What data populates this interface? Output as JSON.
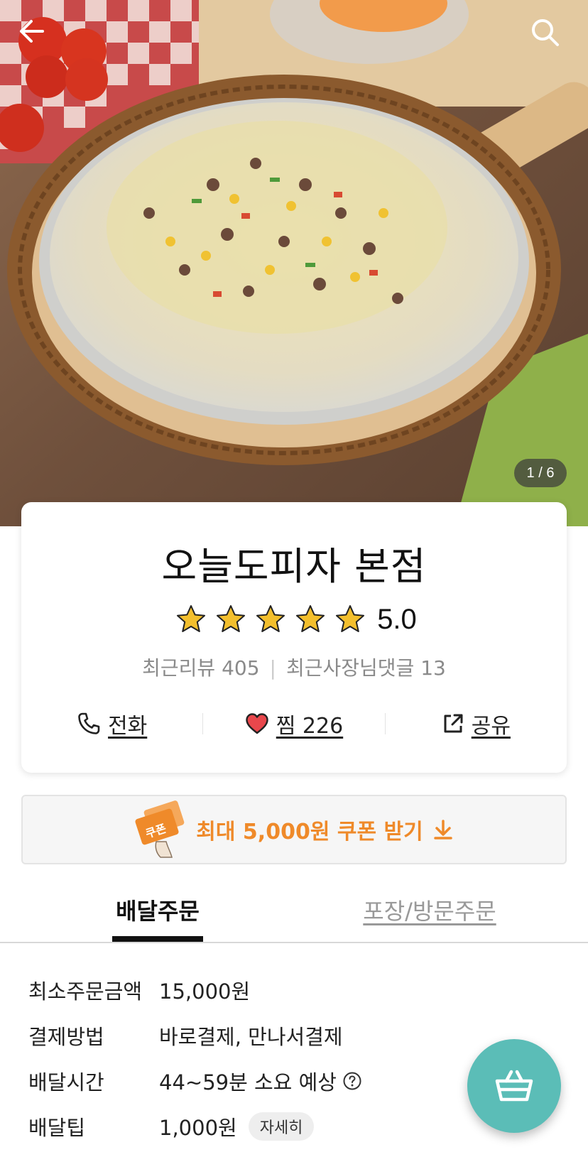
{
  "hero": {
    "page_indicator": "1 / 6"
  },
  "store": {
    "name": "오늘도피자 본점",
    "rating": 5.0,
    "rating_label": "5.0",
    "recent_reviews": "최근리뷰 405",
    "owner_replies": "최근사장님댓글 13"
  },
  "actions": {
    "call": "전화",
    "favorite": "찜 226",
    "share": "공유"
  },
  "coupon": {
    "badge": "쿠폰",
    "label": "최대 5,000원 쿠폰 받기"
  },
  "tabs": {
    "delivery": "배달주문",
    "pickup": "포장/방문주문"
  },
  "info": [
    {
      "label": "최소주문금액",
      "value": "15,000원"
    },
    {
      "label": "결제방법",
      "value": "바로결제, 만나서결제"
    },
    {
      "label": "배달시간",
      "value": "44~59분 소요 예상"
    },
    {
      "label": "배달팁",
      "value": "1,000원",
      "detail": "자세히"
    }
  ],
  "colors": {
    "accent_orange": "#ef8a2a",
    "cart_teal": "#5bbdb7",
    "star_gold": "#f3bf2d",
    "heart_red": "#e8474c"
  },
  "icons": [
    "back-arrow-icon",
    "search-icon",
    "star-icon",
    "phone-icon",
    "heart-icon",
    "share-icon",
    "coupon-icon",
    "download-arrow-icon",
    "help-icon",
    "cart-basket-icon"
  ]
}
